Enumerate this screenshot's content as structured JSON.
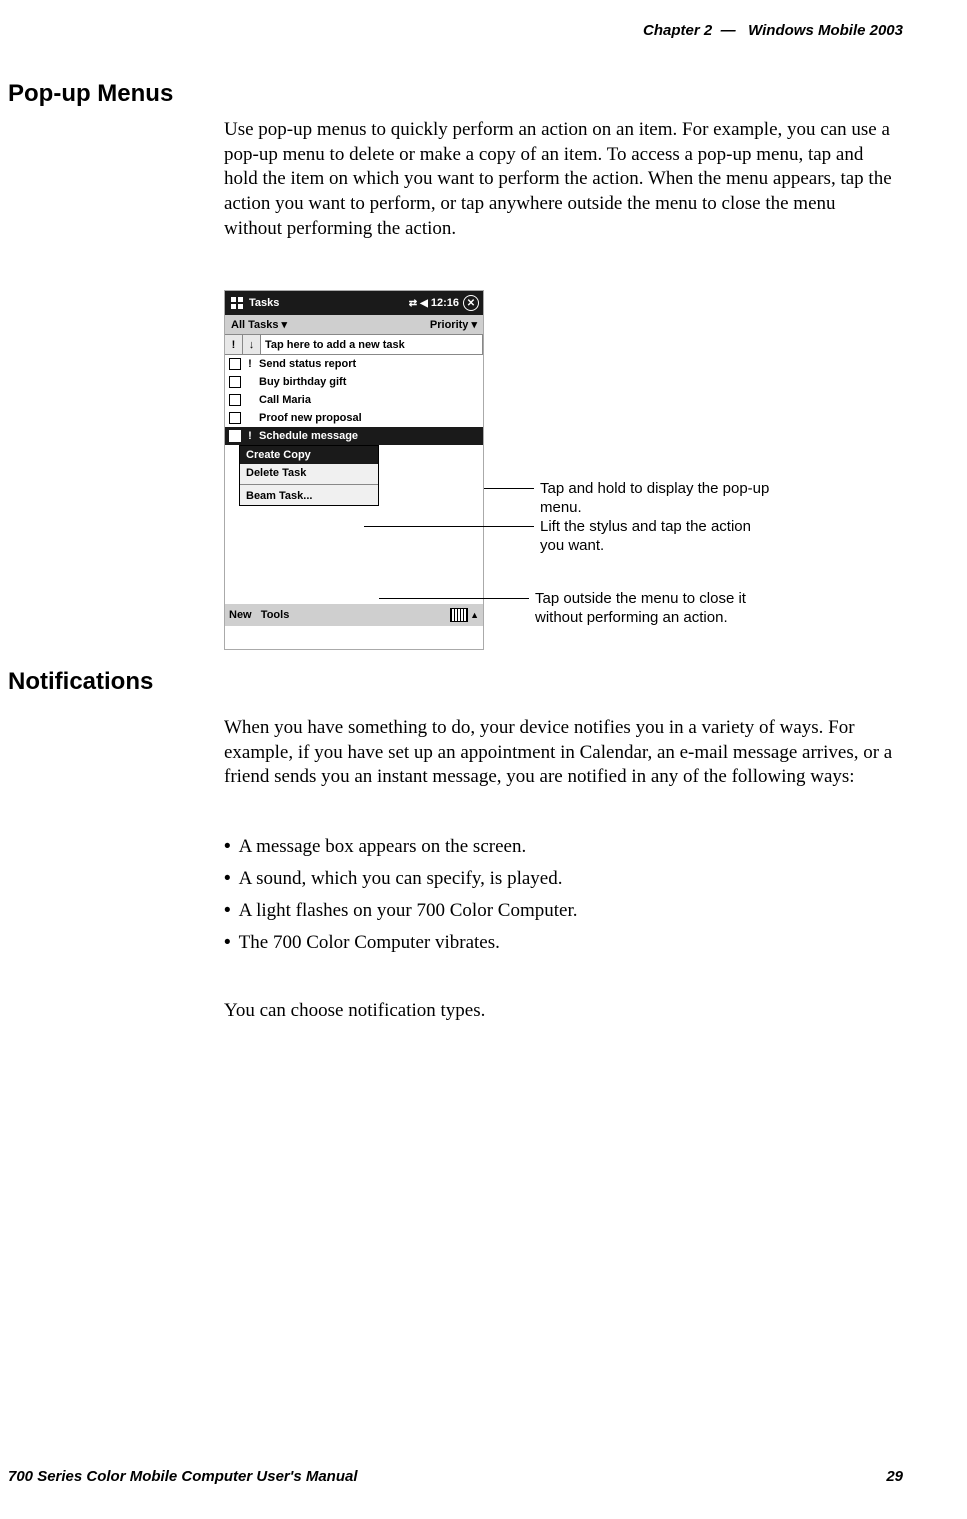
{
  "header": {
    "chapter_label": "Chapter",
    "chapter_number": "2",
    "separator": "—",
    "title": "Windows Mobile 2003"
  },
  "sections": {
    "popup_heading": "Pop-up Menus",
    "popup_paragraph": "Use pop-up menus to quickly perform an action on an item. For example, you can use a pop-up menu to delete or make a copy of an item. To access a pop-up menu, tap and hold the item on which you want to perform the action. When the menu appears, tap the action you want to perform, or tap anywhere outside the menu to close the menu without performing the action.",
    "notifications_heading": "Notifications",
    "notifications_paragraph": "When you have something to do, your device notifies you in a variety of ways. For example, if you have set up an appointment in Calendar, an e-mail message arrives, or a friend sends you an instant message, you are notified in any of the following ways:",
    "bullets": [
      "A message box appears on the screen.",
      "A sound, which you can specify, is played.",
      "A light flashes on your 700 Color Computer.",
      "The 700 Color Computer vibrates."
    ],
    "after_bullets": "You can choose notification types."
  },
  "screenshot": {
    "app_title": "Tasks",
    "clock": "12:16",
    "filter_left": "All Tasks",
    "filter_right": "Priority",
    "add_task_hint": "Tap here to add a new task",
    "tasks": [
      {
        "priority": "!",
        "text": "Send status report"
      },
      {
        "priority": "",
        "text": "Buy birthday gift"
      },
      {
        "priority": "",
        "text": "Call Maria"
      },
      {
        "priority": "",
        "text": "Proof new proposal"
      },
      {
        "priority": "!",
        "text": "Schedule message",
        "selected": true
      }
    ],
    "popup_menu": {
      "items": [
        "Create Copy",
        "Delete Task",
        "Beam Task..."
      ],
      "highlighted_index": 0
    },
    "bottom_left": "New",
    "bottom_left2": "Tools"
  },
  "callouts": {
    "a": "Tap and hold to display the pop-up menu.",
    "b": "Lift the stylus and tap the action you want.",
    "c": "Tap outside the menu to close it without performing an action."
  },
  "footer": {
    "left": "700 Series Color Mobile Computer User's Manual",
    "right": "29"
  }
}
